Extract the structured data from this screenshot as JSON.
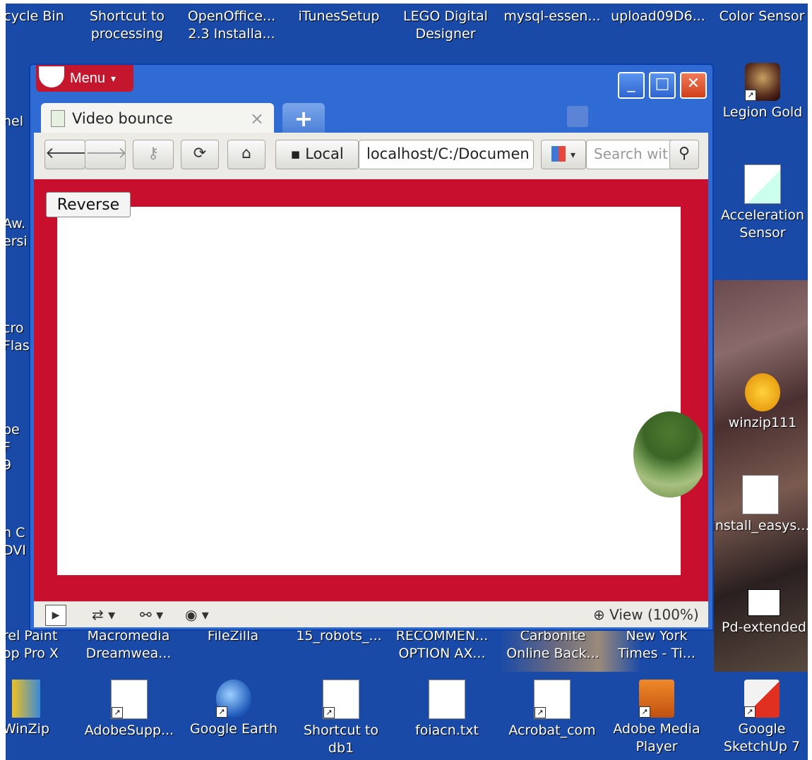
{
  "desktop": {
    "top_icons": [
      "cycle Bin",
      "Shortcut to\nprocessing",
      "OpenOffice...\n2.3 Installa...",
      "iTunesSetup",
      "LEGO Digital\nDesigner",
      "mysql-essen...",
      "upload09D6...",
      "Color Sensor"
    ],
    "right_icons": [
      "Legion Gold",
      "Acceleration\nSensor",
      "winzip111",
      "install_easys...",
      "Pd-extended"
    ],
    "left_icons": [
      "nel",
      "Aw.\nersi",
      "cro\nFlas",
      "be F\n9",
      "n C\nDVI",
      "rel Paint\nop Pro X"
    ],
    "second_bottom_row": [
      "Macromedia\nDreamwea...",
      "FileZilla",
      "15_robots_...",
      "RECOMMEN...\nOPTION AX...",
      "Carbonite\nOnline Back...",
      "New York\nTimes - Ti..."
    ],
    "bottom_icons": [
      "WinZip",
      "AdobeSupp...",
      "Google Earth",
      "Shortcut to\ndb1",
      "foiacn.txt",
      "Acrobat_com",
      "Adobe Media\nPlayer",
      "Google\nSketchUp 7"
    ]
  },
  "browser": {
    "menu_label": "Menu",
    "tab_title": "Video bounce",
    "tab_close": "×",
    "new_tab": "+",
    "address_local": "Local",
    "address_url": "localhost/C:/Documen",
    "search_placeholder": "Search wit",
    "zoom_label": "View (100%)"
  },
  "page": {
    "reverse_button": "Reverse"
  },
  "colors": {
    "desktop": "#1a4aa8",
    "window_frame": "#2f6bd3",
    "content_bg": "#c8102e"
  }
}
